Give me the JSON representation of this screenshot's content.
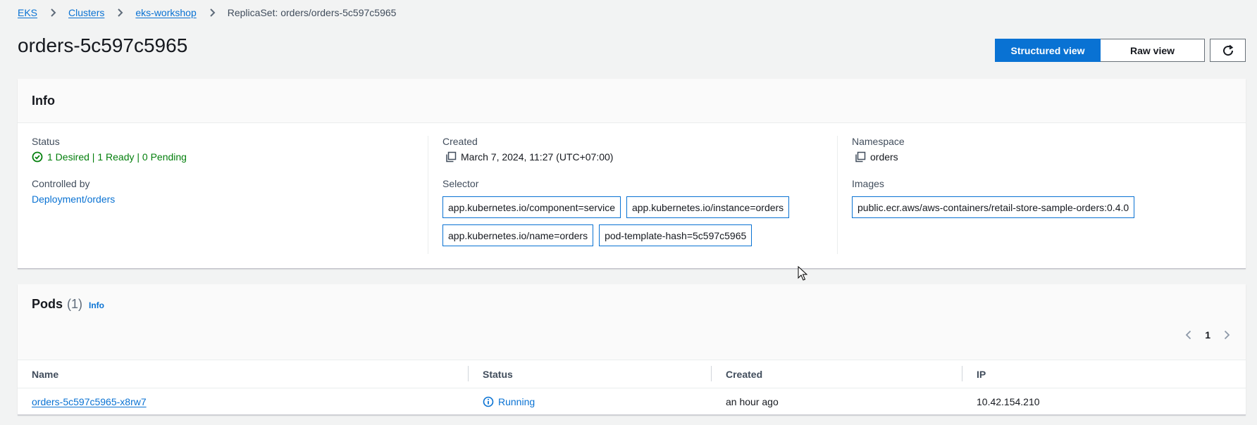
{
  "breadcrumb": {
    "items": [
      "EKS",
      "Clusters",
      "eks-workshop"
    ],
    "current": "ReplicaSet: orders/orders-5c597c5965"
  },
  "page": {
    "title": "orders-5c597c5965"
  },
  "view_toggle": {
    "structured": "Structured view",
    "raw": "Raw view",
    "active": "structured"
  },
  "info": {
    "title": "Info",
    "status_label": "Status",
    "status_value": "1 Desired | 1 Ready | 0 Pending",
    "created_label": "Created",
    "created_value": "March 7, 2024, 11:27 (UTC+07:00)",
    "namespace_label": "Namespace",
    "namespace_value": "orders",
    "controlled_label": "Controlled by",
    "controlled_value": "Deployment/orders",
    "selector_label": "Selector",
    "selectors": [
      "app.kubernetes.io/component=service",
      "app.kubernetes.io/instance=orders",
      "app.kubernetes.io/name=orders",
      "pod-template-hash=5c597c5965"
    ],
    "images_label": "Images",
    "images": [
      "public.ecr.aws/aws-containers/retail-store-sample-orders:0.4.0"
    ]
  },
  "pods": {
    "title": "Pods",
    "count": "(1)",
    "info_link": "Info",
    "page": "1",
    "columns": [
      "Name",
      "Status",
      "Created",
      "IP"
    ],
    "rows": [
      {
        "name": "orders-5c597c5965-x8rw7",
        "status": "Running",
        "created": "an hour ago",
        "ip": "10.42.154.210"
      }
    ]
  },
  "colors": {
    "accent": "#0972d3",
    "success": "#037f0c",
    "background": "#f2f3f3"
  }
}
